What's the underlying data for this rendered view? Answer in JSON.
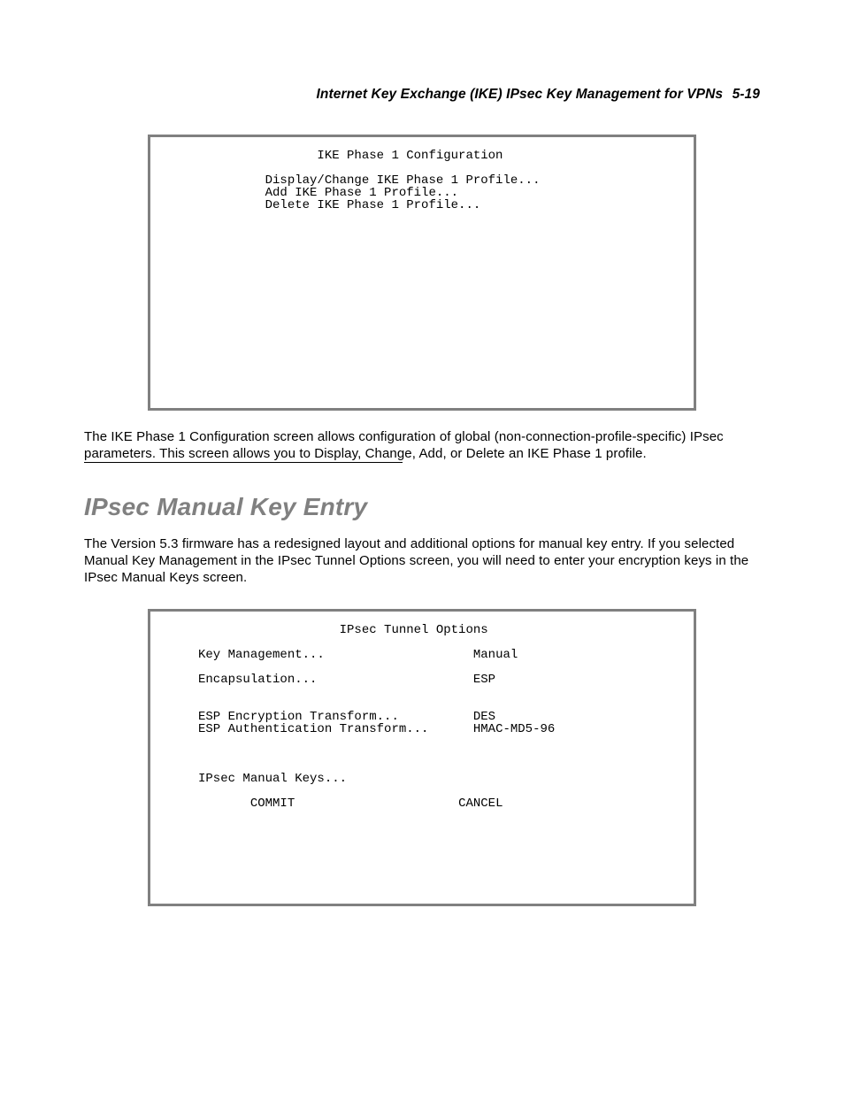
{
  "header": {
    "title": "Internet Key Exchange (IKE) IPsec Key Management for VPNs",
    "page_number": "5-19"
  },
  "terminal1": {
    "title_line": "                     IKE Phase 1 Configuration",
    "items": [
      "              Display/Change IKE Phase 1 Profile...",
      "              Add IKE Phase 1 Profile...",
      "              Delete IKE Phase 1 Profile..."
    ]
  },
  "paragraph1": "The IKE Phase 1 Configuration screen allows configuration of global (non-connection-profile-specific) IPsec parameters. This screen allows you to Display, Change, Add, or Delete an IKE Phase 1 profile.",
  "section_heading": "IPsec Manual Key Entry",
  "paragraph2": "The Version 5.3 firmware has a redesigned layout and additional options for manual key entry. If you selected Manual Key Management in the IPsec Tunnel Options screen, you will need to enter your encryption keys in the IPsec Manual Keys screen.",
  "terminal2": {
    "title_line": "                        IPsec Tunnel Options",
    "rows": [
      {
        "label": "     Key Management...                    ",
        "value": "Manual"
      },
      {
        "label": "",
        "value": ""
      },
      {
        "label": "     Encapsulation...                     ",
        "value": "ESP"
      },
      {
        "label": "",
        "value": ""
      },
      {
        "label": "",
        "value": ""
      },
      {
        "label": "     ESP Encryption Transform...          ",
        "value": "DES"
      },
      {
        "label": "     ESP Authentication Transform...      ",
        "value": "HMAC-MD5-96"
      },
      {
        "label": "",
        "value": ""
      },
      {
        "label": "",
        "value": ""
      },
      {
        "label": "",
        "value": ""
      },
      {
        "label": "     IPsec Manual Keys...",
        "value": ""
      },
      {
        "label": "",
        "value": ""
      }
    ],
    "commit": "            COMMIT                      ",
    "cancel": "CANCEL"
  }
}
